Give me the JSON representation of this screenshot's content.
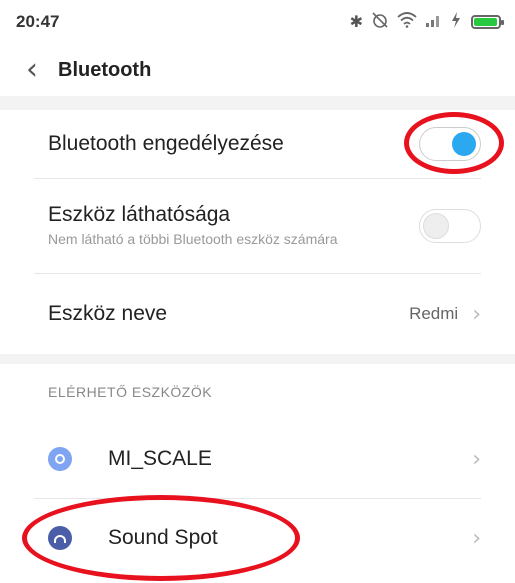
{
  "status_bar": {
    "time": "20:47",
    "icons": [
      "bluetooth-icon",
      "alarm-off-icon",
      "wifi-icon",
      "signal-icon",
      "charging-icon",
      "battery-icon"
    ],
    "battery_level": 0.95,
    "battery_color": "#27c93f"
  },
  "header": {
    "back_icon": "chevron-left-icon",
    "title": "Bluetooth"
  },
  "settings": {
    "enable": {
      "label": "Bluetooth engedélyezése",
      "toggle_state": "on",
      "accent": "#2aa8f0"
    },
    "visibility": {
      "label": "Eszköz láthatósága",
      "sublabel": "Nem látható a többi Bluetooth eszköz számára",
      "toggle_state": "off"
    },
    "device_name": {
      "label": "Eszköz neve",
      "value": "Redmi"
    }
  },
  "available": {
    "header": "ELÉRHETŐ ESZKÖZÖK",
    "devices": [
      {
        "name": "MI_SCALE",
        "icon": "scale-device-icon",
        "icon_color": "#7fa4f1"
      },
      {
        "name": "Sound Spot",
        "icon": "headphones-icon",
        "icon_color": "#4a5ea8"
      }
    ]
  },
  "annotation_color": "#e8111e"
}
